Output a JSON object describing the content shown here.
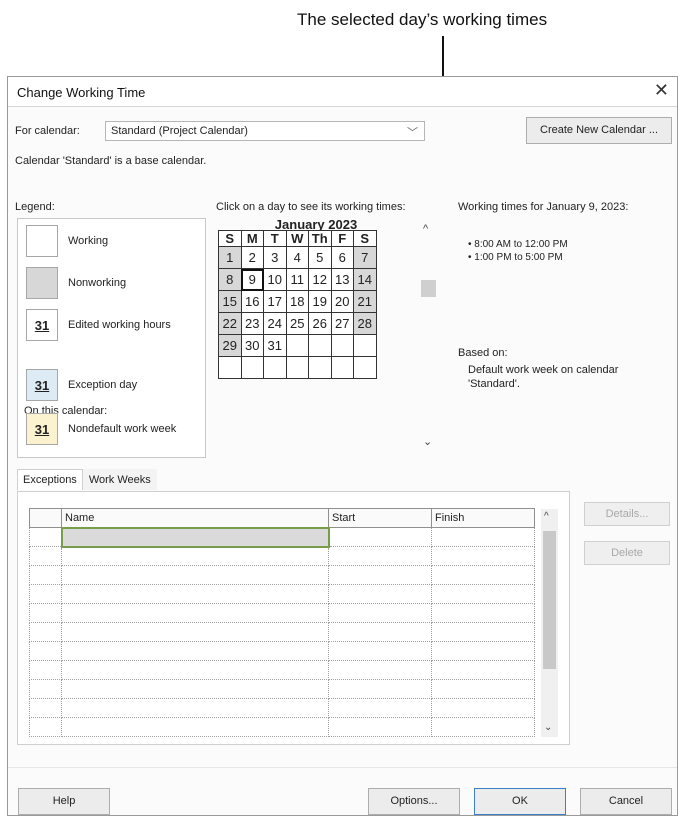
{
  "callout": {
    "text": "The selected day’s working times"
  },
  "dialog": {
    "title": "Change Working Time",
    "close_glyph": "✕",
    "for_calendar_label": "For calendar:",
    "calendar_value": "Standard (Project Calendar)",
    "create_new_calendar": "Create New Calendar ...",
    "base_info": "Calendar 'Standard' is a base calendar."
  },
  "legend": {
    "label": "Legend:",
    "on_this_calendar": "On this calendar:",
    "items": [
      {
        "swatch": "",
        "text": "Working"
      },
      {
        "swatch": "",
        "text": "Nonworking"
      },
      {
        "swatch": "31",
        "text": "Edited working hours"
      },
      {
        "swatch": "31",
        "text": "Exception day"
      },
      {
        "swatch": "31",
        "text": "Nondefault work week"
      }
    ]
  },
  "calendar": {
    "instruction": "Click on a day to see its working times:",
    "month": "January 2023",
    "weekday_headers": [
      "S",
      "M",
      "T",
      "W",
      "Th",
      "F",
      "S"
    ],
    "weeks": [
      [
        "1",
        "2",
        "3",
        "4",
        "5",
        "6",
        "7"
      ],
      [
        "8",
        "9",
        "10",
        "11",
        "12",
        "13",
        "14"
      ],
      [
        "15",
        "16",
        "17",
        "18",
        "19",
        "20",
        "21"
      ],
      [
        "22",
        "23",
        "24",
        "25",
        "26",
        "27",
        "28"
      ],
      [
        "29",
        "30",
        "31",
        "",
        "",
        "",
        ""
      ],
      [
        "",
        "",
        "",
        "",
        "",
        "",
        ""
      ]
    ],
    "selected_day": "9",
    "scroll_up": "^",
    "scroll_down": "⌄"
  },
  "working_times": {
    "title": "Working times for January 9, 2023:",
    "ranges": [
      "• 8:00 AM to 12:00 PM",
      "• 1:00 PM to 5:00 PM"
    ],
    "based_on_label": "Based on:",
    "based_on_text": "Default work week on calendar 'Standard'."
  },
  "tabs": [
    {
      "label": "Exceptions",
      "active": true
    },
    {
      "label": "Work Weeks",
      "active": false
    }
  ],
  "exceptions_table": {
    "columns": [
      "Name",
      "Start",
      "Finish"
    ],
    "row_count": 11
  },
  "side_buttons": {
    "details": "Details...",
    "delete": "Delete"
  },
  "footer": {
    "help": "Help",
    "options": "Options...",
    "ok": "OK",
    "cancel": "Cancel"
  },
  "colors": {
    "nonworking": "#d7d7d7",
    "exception": "#dcebf4",
    "nondefault": "#fbf3cf",
    "ok_border": "#3c7fc8"
  }
}
